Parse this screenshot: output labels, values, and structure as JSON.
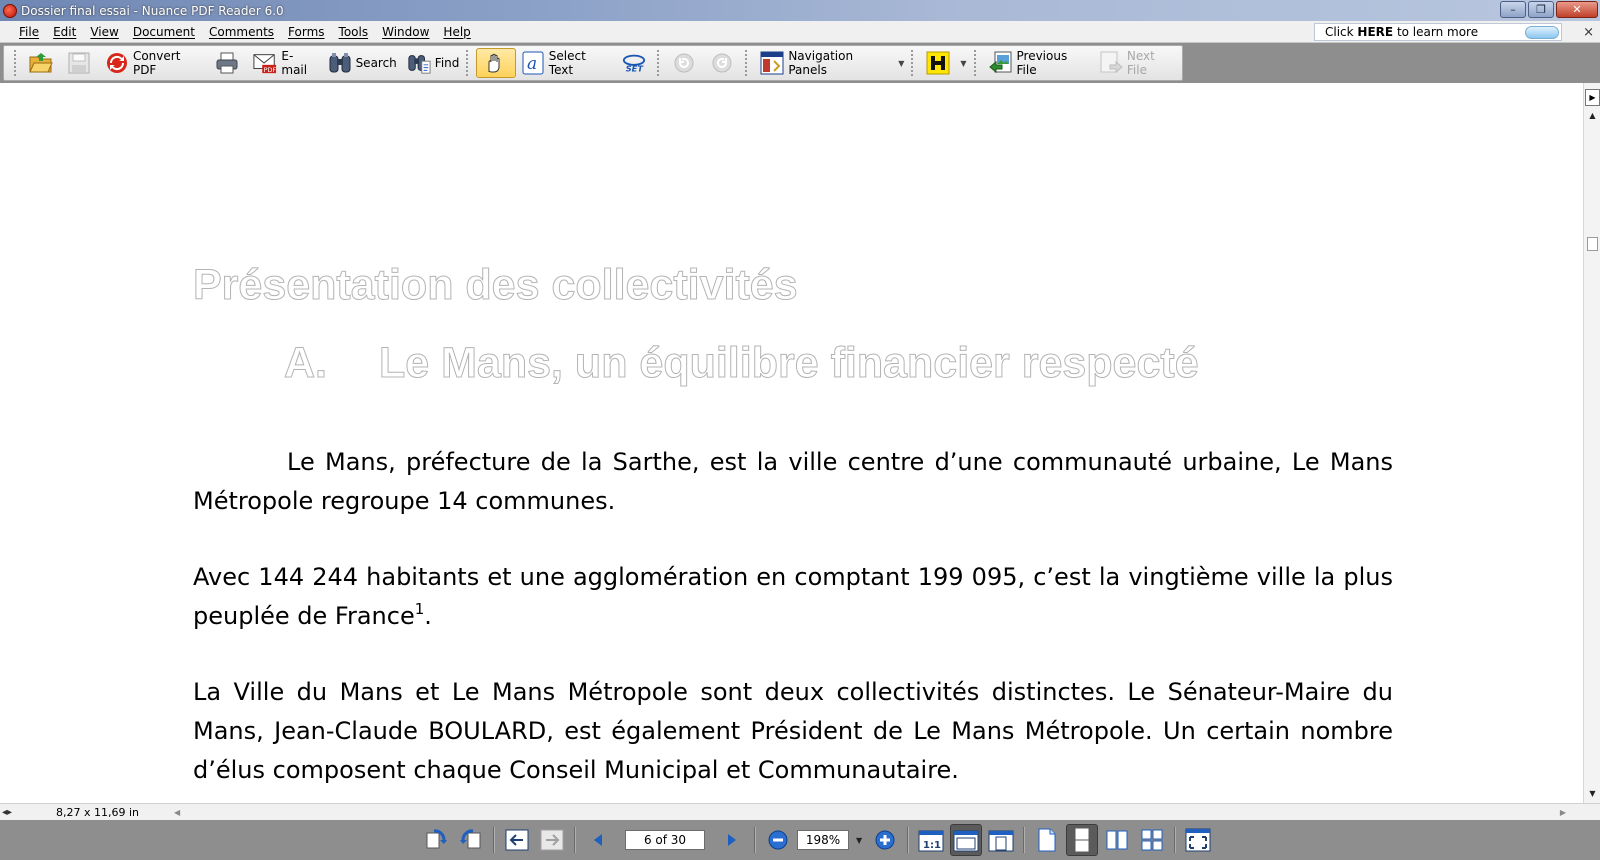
{
  "window": {
    "title": "Dossier final essai - Nuance PDF Reader 6.0",
    "minimize": "–",
    "restore": "❐",
    "close": "✕"
  },
  "menu": [
    "File",
    "Edit",
    "View",
    "Document",
    "Comments",
    "Forms",
    "Tools",
    "Window",
    "Help"
  ],
  "ad": {
    "prefix": "Click ",
    "bold": "HERE",
    "suffix": " to learn more",
    "close": "×"
  },
  "toolbar": {
    "convert_pdf": "Convert PDF",
    "email": "E-mail",
    "search": "Search",
    "find": "Find",
    "select_text": "Select Text",
    "navigation_panels": "Navigation Panels",
    "previous_file": "Previous File",
    "next_file": "Next File"
  },
  "document": {
    "heading1": "Présentation des collectivités",
    "heading2_letter": "A.",
    "heading2_text": "Le Mans, un équilibre financier respecté",
    "paragraph1": "Le Mans, préfecture de la Sarthe, est la ville centre d’une communauté urbaine, Le Mans Métropole regroupe 14 communes.",
    "paragraph2_text": "Avec 144 244 habitants et une agglomération en comptant 199 095, c’est la vingtième ville la plus peuplée de France",
    "paragraph2_footnote": "1",
    "paragraph2_end": ".",
    "paragraph3": "La Ville du Mans et Le Mans Métropole sont deux collectivités distinctes. Le Sénateur-Maire du Mans, Jean-Claude BOULARD, est également Président de Le Mans Métropole. Un certain nombre d’élus composent chaque Conseil Municipal et Communautaire."
  },
  "status": {
    "page_size": "8,27 x 11,69 in"
  },
  "navigation": {
    "page_indicator": "6 of 30",
    "zoom": "198%"
  },
  "colors": {
    "accent": "#ffd25a",
    "nav_blue": "#1f5fbf",
    "title_gradient_start": "#6f87b3"
  }
}
